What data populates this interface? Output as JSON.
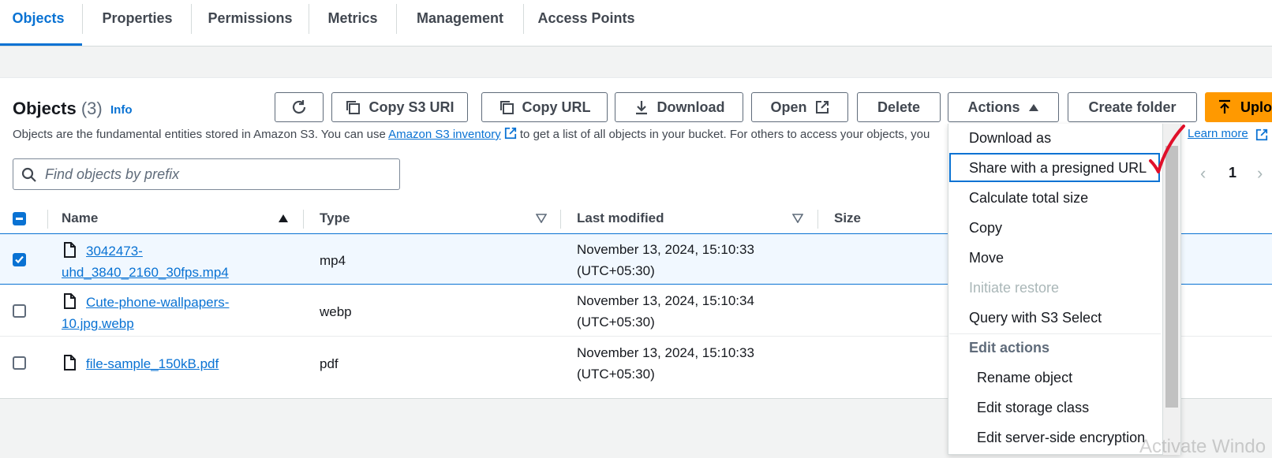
{
  "tabs": [
    {
      "label": "Objects"
    },
    {
      "label": "Properties"
    },
    {
      "label": "Permissions"
    },
    {
      "label": "Metrics"
    },
    {
      "label": "Management"
    },
    {
      "label": "Access Points"
    }
  ],
  "objects_panel": {
    "title": "Objects",
    "count": "(3)",
    "info_link": "Info",
    "description_start": "Objects are the fundamental entities stored in Amazon S3. You can use ",
    "inventory_link": "Amazon S3 inventory",
    "description_end": " to get a list of all objects in your bucket. For others to access your objects, you",
    "description_tail": "s.",
    "learn_more": "Learn more"
  },
  "toolbar": {
    "copy_s3_uri": "Copy S3 URI",
    "copy_url": "Copy URL",
    "download": "Download",
    "open": "Open",
    "delete": "Delete",
    "actions": "Actions",
    "create_folder": "Create folder",
    "upload": "Uplo"
  },
  "search": {
    "placeholder": "Find objects by prefix"
  },
  "pagination": {
    "page": "1"
  },
  "table": {
    "columns": {
      "name": "Name",
      "type": "Type",
      "last_modified": "Last modified",
      "size": "Size"
    },
    "rows": [
      {
        "name_line1": "3042473-",
        "name_line2": "uhd_3840_2160_30fps.mp4",
        "type": "mp4",
        "modified_line1": "November 13, 2024, 15:10:33",
        "modified_line2": "(UTC+05:30)",
        "selected": true
      },
      {
        "name_line1": "Cute-phone-wallpapers-",
        "name_line2": "10.jpg.webp",
        "type": "webp",
        "modified_line1": "November 13, 2024, 15:10:34",
        "modified_line2": "(UTC+05:30)",
        "selected": false
      },
      {
        "name_line1": "file-sample_150kB.pdf",
        "name_line2": "",
        "type": "pdf",
        "modified_line1": "November 13, 2024, 15:10:33",
        "modified_line2": "(UTC+05:30)",
        "selected": false
      }
    ]
  },
  "actions_menu": {
    "items": [
      {
        "label": "Download as"
      },
      {
        "label": "Share with a presigned URL"
      },
      {
        "label": "Calculate total size"
      },
      {
        "label": "Copy"
      },
      {
        "label": "Move"
      },
      {
        "label": "Initiate restore"
      },
      {
        "label": "Query with S3 Select"
      }
    ],
    "group_label": "Edit actions",
    "edit_items": [
      {
        "label": "Rename object"
      },
      {
        "label": "Edit storage class"
      },
      {
        "label": "Edit server-side encryption"
      }
    ]
  },
  "watermark": "Activate Windo",
  "colors": {
    "accent": "#0972d3",
    "primary_button": "#ff9900",
    "annotation_check": "#e0102a"
  }
}
